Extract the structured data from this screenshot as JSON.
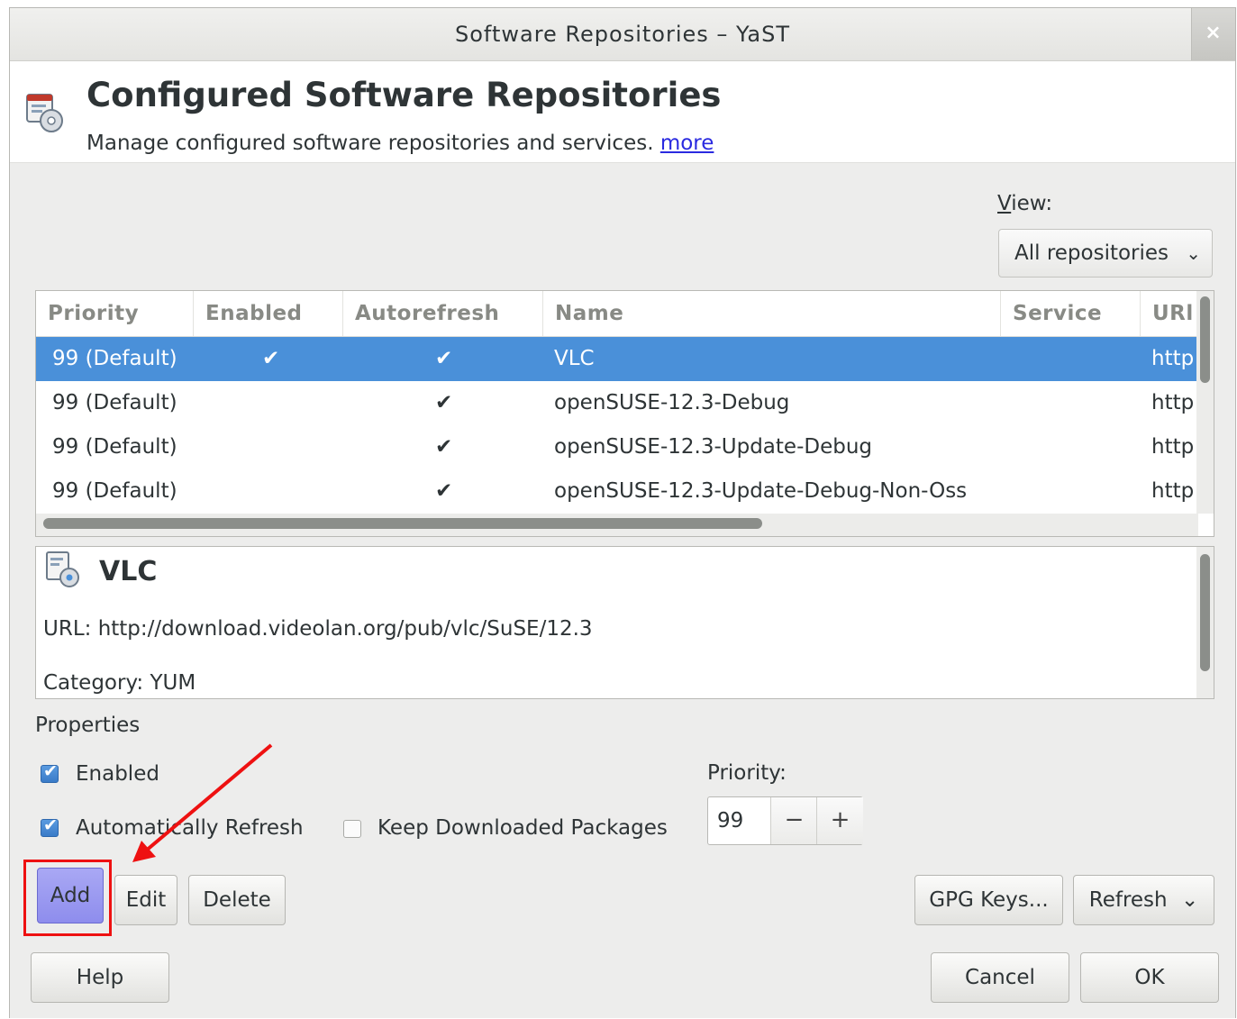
{
  "window": {
    "title": "Software Repositories – YaST",
    "close_glyph": "×"
  },
  "header": {
    "icon": "software-repositories-icon",
    "title": "Configured Software Repositories",
    "subtitle": "Manage configured software repositories and services.",
    "more_link": "more"
  },
  "view": {
    "label_first": "V",
    "label_rest": "iew:",
    "selected": "All repositories",
    "chevron": "⌄"
  },
  "table": {
    "columns": [
      "Priority",
      "Enabled",
      "Autorefresh",
      "Name",
      "Service",
      "URl"
    ],
    "rows": [
      {
        "priority": "99 (Default)",
        "enabled": "✔",
        "autorefresh": "✔",
        "name": "VLC",
        "service": "",
        "url": "http"
      },
      {
        "priority": "99 (Default)",
        "enabled": "",
        "autorefresh": "✔",
        "name": "openSUSE-12.3-Debug",
        "service": "",
        "url": "http"
      },
      {
        "priority": "99 (Default)",
        "enabled": "",
        "autorefresh": "✔",
        "name": "openSUSE-12.3-Update-Debug",
        "service": "",
        "url": "http"
      },
      {
        "priority": "99 (Default)",
        "enabled": "",
        "autorefresh": "✔",
        "name": "openSUSE-12.3-Update-Debug-Non-Oss",
        "service": "",
        "url": "http"
      }
    ],
    "selected_row": 0
  },
  "details": {
    "title": "VLC",
    "url_line": "URL: http://download.videolan.org/pub/vlc/SuSE/12.3",
    "category_line": "Category: YUM"
  },
  "properties": {
    "label": "Properties",
    "enabled_label": "Enabled",
    "enabled_checked": true,
    "autorefresh_label": "Automatically Refresh",
    "autorefresh_checked": true,
    "keep_packages_label": "Keep Downloaded Packages",
    "keep_packages_checked": false,
    "priority_label": "Priority:",
    "priority_value": "99",
    "minus_glyph": "−",
    "plus_glyph": "+"
  },
  "buttons": {
    "add": "Add",
    "edit": "Edit",
    "delete": "Delete",
    "gpg_keys": "GPG Keys...",
    "refresh": "Refresh",
    "refresh_chevron": "⌄",
    "help": "Help",
    "cancel": "Cancel",
    "ok": "OK"
  },
  "colors": {
    "selection": "#4a90d9",
    "annotation_red": "#ee1111",
    "add_button": "#9d9cf0"
  }
}
